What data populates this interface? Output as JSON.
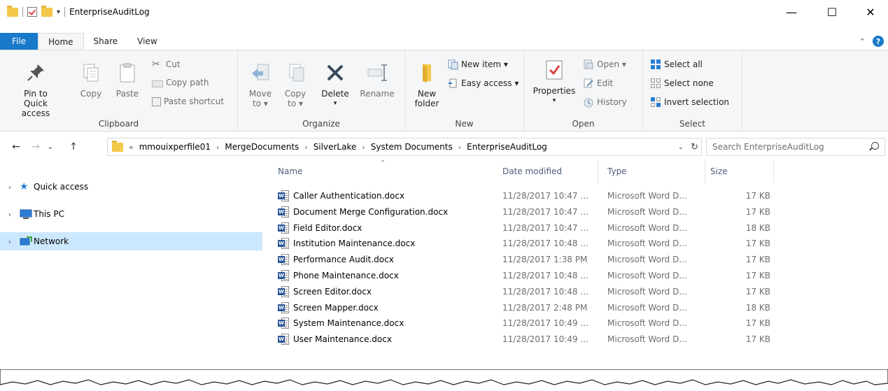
{
  "window": {
    "title": "EnterpriseAuditLog",
    "minimize": "—",
    "maximize": "☐",
    "close": "✕"
  },
  "ribbon_tabs": [
    {
      "label": "File"
    },
    {
      "label": "Home"
    },
    {
      "label": "Share"
    },
    {
      "label": "View"
    }
  ],
  "clipboard": {
    "group_label": "Clipboard",
    "pin_line1": "Pin to Quick",
    "pin_line2": "access",
    "copy": "Copy",
    "paste": "Paste",
    "cut": "Cut",
    "copy_path": "Copy path",
    "paste_shortcut": "Paste shortcut"
  },
  "organize": {
    "group_label": "Organize",
    "move_line1": "Move",
    "move_line2": "to ▾",
    "copy_line1": "Copy",
    "copy_line2": "to ▾",
    "delete": "Delete",
    "rename": "Rename"
  },
  "new": {
    "group_label": "New",
    "folder_line1": "New",
    "folder_line2": "folder",
    "new_item": "New item ▾",
    "easy_access": "Easy access ▾"
  },
  "open": {
    "group_label": "Open",
    "properties": "Properties",
    "open": "Open ▾",
    "edit": "Edit",
    "history": "History"
  },
  "select": {
    "group_label": "Select",
    "select_all": "Select all",
    "select_none": "Select none",
    "invert": "Invert selection"
  },
  "address": {
    "overflow": "«",
    "crumbs": [
      "mmouixperfile01",
      "MergeDocuments",
      "SilverLake",
      "System Documents",
      "EnterpriseAuditLog"
    ],
    "separator": "›",
    "search_placeholder": "Search EnterpriseAuditLog"
  },
  "nav_pane": [
    {
      "label": "Quick access",
      "icon": "star-icon"
    },
    {
      "label": "This PC",
      "icon": "computer-icon"
    },
    {
      "label": "Network",
      "icon": "network-icon",
      "selected": true
    }
  ],
  "columns": {
    "name": "Name",
    "date": "Date modified",
    "type": "Type",
    "size": "Size"
  },
  "files": [
    {
      "name": "Caller Authentication.docx",
      "date": "11/28/2017 10:47 ...",
      "type": "Microsoft Word D...",
      "size": "17 KB"
    },
    {
      "name": "Document Merge Configuration.docx",
      "date": "11/28/2017 10:47 ...",
      "type": "Microsoft Word D...",
      "size": "17 KB"
    },
    {
      "name": "Field Editor.docx",
      "date": "11/28/2017 10:47 ...",
      "type": "Microsoft Word D...",
      "size": "18 KB"
    },
    {
      "name": "Institution Maintenance.docx",
      "date": "11/28/2017 10:48 ...",
      "type": "Microsoft Word D...",
      "size": "17 KB"
    },
    {
      "name": "Performance Audit.docx",
      "date": "11/28/2017 1:38 PM",
      "type": "Microsoft Word D...",
      "size": "17 KB"
    },
    {
      "name": "Phone Maintenance.docx",
      "date": "11/28/2017 10:48 ...",
      "type": "Microsoft Word D...",
      "size": "17 KB"
    },
    {
      "name": "Screen Editor.docx",
      "date": "11/28/2017 10:48 ...",
      "type": "Microsoft Word D...",
      "size": "17 KB"
    },
    {
      "name": "Screen Mapper.docx",
      "date": "11/28/2017 2:48 PM",
      "type": "Microsoft Word D...",
      "size": "18 KB"
    },
    {
      "name": "System Maintenance.docx",
      "date": "11/28/2017 10:49 ...",
      "type": "Microsoft Word D...",
      "size": "17 KB"
    },
    {
      "name": "User Maintenance.docx",
      "date": "11/28/2017 10:49 ...",
      "type": "Microsoft Word D...",
      "size": "17 KB"
    }
  ],
  "colors": {
    "accent": "#1979ca",
    "selection": "#cce8ff",
    "word": "#2b579a"
  }
}
